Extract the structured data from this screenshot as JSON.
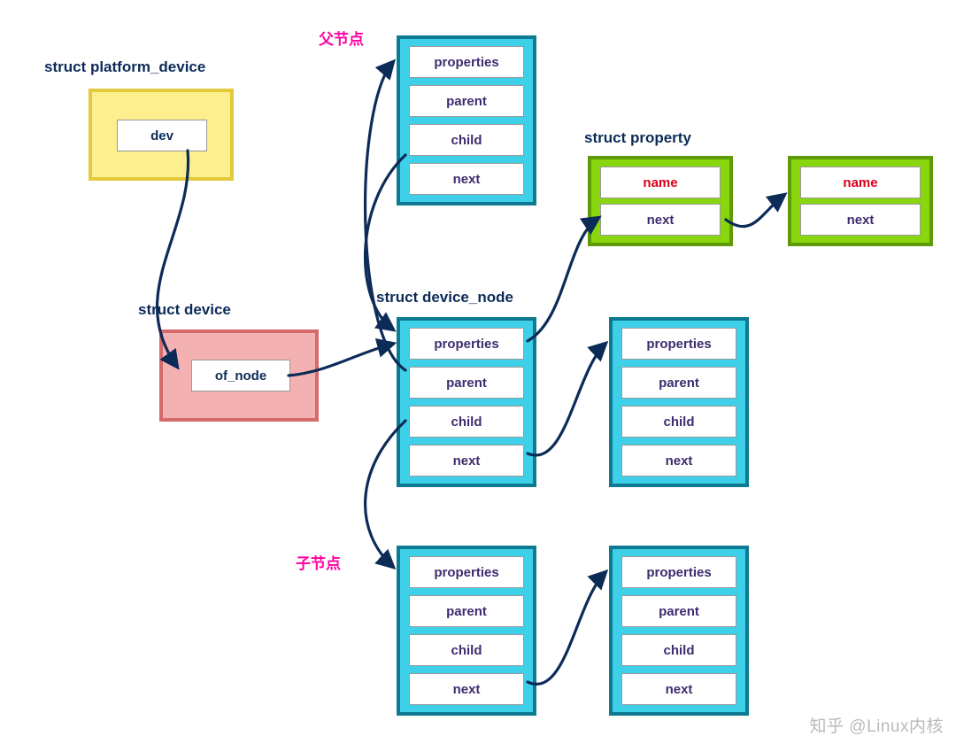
{
  "labels": {
    "platform_device": "struct platform_device",
    "device": "struct device",
    "parent_node": "父节点",
    "child_node": "子节点",
    "device_node": "struct device_node",
    "property": "struct property"
  },
  "platform_device_box": {
    "dev": "dev"
  },
  "device_box": {
    "of_node": "of_node"
  },
  "device_node_fields": {
    "properties": "properties",
    "parent": "parent",
    "child": "child",
    "next": "next"
  },
  "property_fields": {
    "name": "name",
    "next": "next"
  },
  "watermark": "知乎 @Linux内核",
  "colors": {
    "navy": "#0c2b57",
    "magenta": "#ff00a0",
    "cyan_fill": "#3fd0e9",
    "cyan_border": "#0e7a91",
    "yellow_fill": "#fdef8e",
    "yellow_border": "#e3c93d",
    "pink_fill": "#f4b1b1",
    "pink_border": "#d46a6a",
    "lime_fill": "#89d60f",
    "lime_border": "#5f9a07",
    "field_text": "#3e2c6f",
    "red": "#d9001b"
  }
}
